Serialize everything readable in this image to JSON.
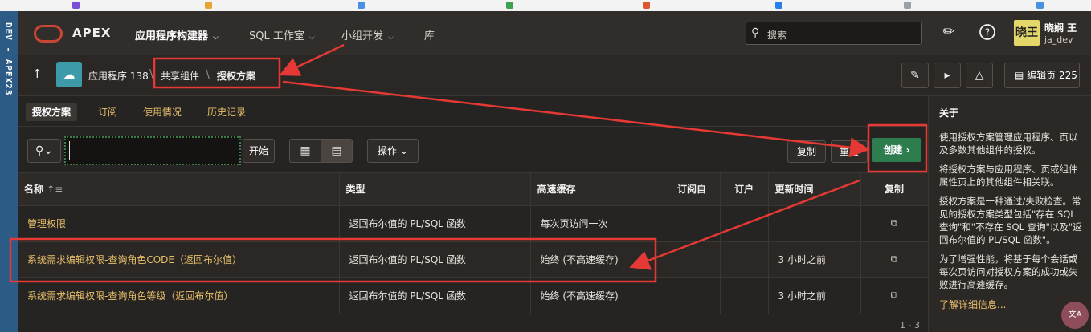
{
  "devbar": {
    "text": "DEV - APEX23"
  },
  "topnav": {
    "brand": "APEX",
    "items": [
      {
        "label": "应用程序构建器",
        "chevron": "⌵"
      },
      {
        "label": "SQL 工作室",
        "chevron": "⌵"
      },
      {
        "label": "小组开发",
        "chevron": "⌵"
      },
      {
        "label": "库"
      }
    ],
    "search_placeholder": "搜索",
    "user": {
      "avatar": "晓王",
      "name": "晓娴 王",
      "id": "ja_dev"
    }
  },
  "breadcrumb": {
    "app": "应用程序 138",
    "shared": "共享组件",
    "current": "授权方案",
    "edit_page": "编辑页 225"
  },
  "tabs": [
    "授权方案",
    "订阅",
    "使用情况",
    "历史记录"
  ],
  "toolbar": {
    "go": "开始",
    "actions": "操作",
    "copy": "复制",
    "reset": "重置",
    "create": "创建 ›",
    "search_value": ""
  },
  "table": {
    "headers": [
      "名称",
      "类型",
      "高速缓存",
      "订阅自",
      "订户",
      "更新时间",
      "复制"
    ],
    "rows": [
      [
        "管理权限",
        "返回布尔值的 PL/SQL 函数",
        "每次页访问一次",
        "",
        "",
        "",
        ""
      ],
      [
        "系统需求编辑权限-查询角色CODE（返回布尔值）",
        "返回布尔值的 PL/SQL 函数",
        "始终 (不高速缓存)",
        "",
        "",
        "3 小时之前",
        ""
      ],
      [
        "系统需求编辑权限-查询角色等级（返回布尔值）",
        "返回布尔值的 PL/SQL 函数",
        "始终 (不高速缓存)",
        "",
        "",
        "3 小时之前",
        ""
      ]
    ],
    "pager": "1 - 3"
  },
  "side": {
    "title": "关于",
    "paragraphs": [
      "使用授权方案管理应用程序、页以及多数其他组件的授权。",
      "将授权方案与应用程序、页或组件属性页上的其他组件相关联。",
      "授权方案是一种通过/失败检查。常见的授权方案类型包括\"存在 SQL 查询\"和\"不存在 SQL 查询\"以及\"返回布尔值的 PL/SQL 函数\"。",
      "为了增强性能，将基于每个会话或每次页访问对授权方案的成功或失败进行高速缓存。"
    ],
    "more": "了解详细信息..."
  },
  "colors": {
    "accent": "#e9c16a",
    "create": "#2e7d4f",
    "annotation": "#e53935"
  }
}
